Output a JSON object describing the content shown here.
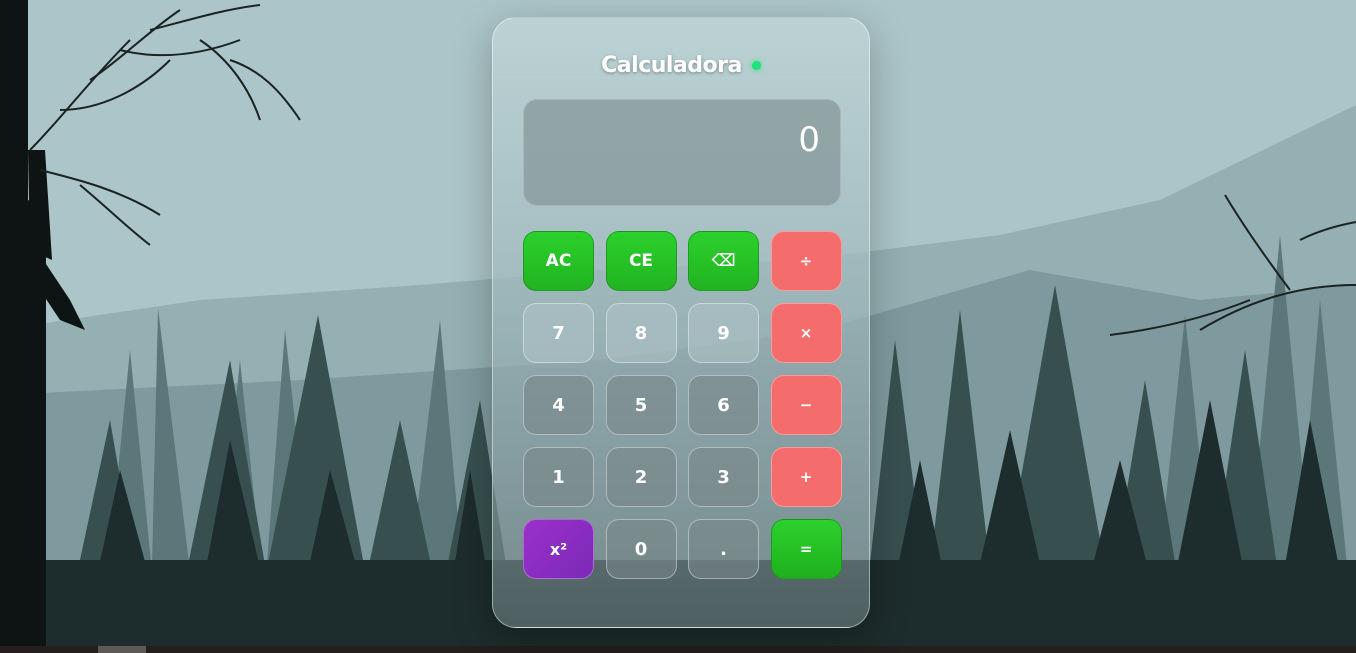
{
  "calculator": {
    "title": "Calculadora",
    "display_value": "0",
    "keys": [
      {
        "id": "ac",
        "label": "AC",
        "kind": "func"
      },
      {
        "id": "ce",
        "label": "CE",
        "kind": "func"
      },
      {
        "id": "backspace",
        "label": "⌫",
        "kind": "func"
      },
      {
        "id": "divide",
        "label": "÷",
        "kind": "op"
      },
      {
        "id": "7",
        "label": "7",
        "kind": "num"
      },
      {
        "id": "8",
        "label": "8",
        "kind": "num"
      },
      {
        "id": "9",
        "label": "9",
        "kind": "num"
      },
      {
        "id": "multiply",
        "label": "×",
        "kind": "op"
      },
      {
        "id": "4",
        "label": "4",
        "kind": "num"
      },
      {
        "id": "5",
        "label": "5",
        "kind": "num"
      },
      {
        "id": "6",
        "label": "6",
        "kind": "num"
      },
      {
        "id": "minus",
        "label": "−",
        "kind": "op"
      },
      {
        "id": "1",
        "label": "1",
        "kind": "num"
      },
      {
        "id": "2",
        "label": "2",
        "kind": "num"
      },
      {
        "id": "3",
        "label": "3",
        "kind": "num"
      },
      {
        "id": "plus",
        "label": "+",
        "kind": "op"
      },
      {
        "id": "square",
        "label": "x²",
        "kind": "pow"
      },
      {
        "id": "0",
        "label": "0",
        "kind": "num"
      },
      {
        "id": "decimal",
        "label": ".",
        "kind": "num"
      },
      {
        "id": "equals",
        "label": "=",
        "kind": "eq"
      }
    ]
  },
  "colors": {
    "status_dot": "#1ee37a",
    "func_key": "#2bd12b",
    "operator_key": "#f56c6c",
    "power_key": "#8e2ec3",
    "equals_key": "#22c322",
    "sky": "#aac4c7"
  },
  "background": {
    "description_icon": "forest-landscape"
  }
}
